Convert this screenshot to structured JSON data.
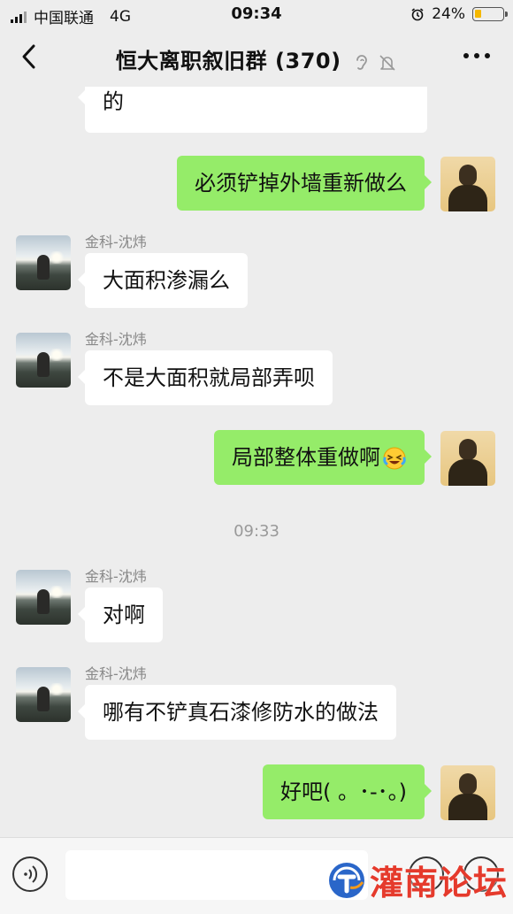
{
  "status_bar": {
    "carrier": "中国联通",
    "network": "4G",
    "time": "09:34",
    "battery": "24%",
    "battery_level": 0.24
  },
  "nav": {
    "title": "恒大离职叙旧群 (370)"
  },
  "messages": [
    {
      "side": "left",
      "text": "的"
    },
    {
      "side": "right",
      "text": "必须铲掉外墙重新做么"
    },
    {
      "side": "left",
      "sender": "金科-沈炜",
      "text": "大面积渗漏么"
    },
    {
      "side": "left",
      "sender": "金科-沈炜",
      "text": "不是大面积就局部弄呗"
    },
    {
      "side": "right",
      "text": "局部整体重做啊",
      "emoji": "laughing-tears-emoji"
    },
    {
      "timestamp": "09:33"
    },
    {
      "side": "left",
      "sender": "金科-沈炜",
      "text": "对啊"
    },
    {
      "side": "left",
      "sender": "金科-沈炜",
      "text": "哪有不铲真石漆修防水的做法"
    },
    {
      "side": "right",
      "text": "好吧( 。･-･。)"
    }
  ],
  "watermark": {
    "text": "灌南论坛"
  },
  "colors": {
    "background": "#ededed",
    "bubble_self": "#95ec69",
    "bubble_other": "#ffffff",
    "watermark": "#e53a2c"
  }
}
